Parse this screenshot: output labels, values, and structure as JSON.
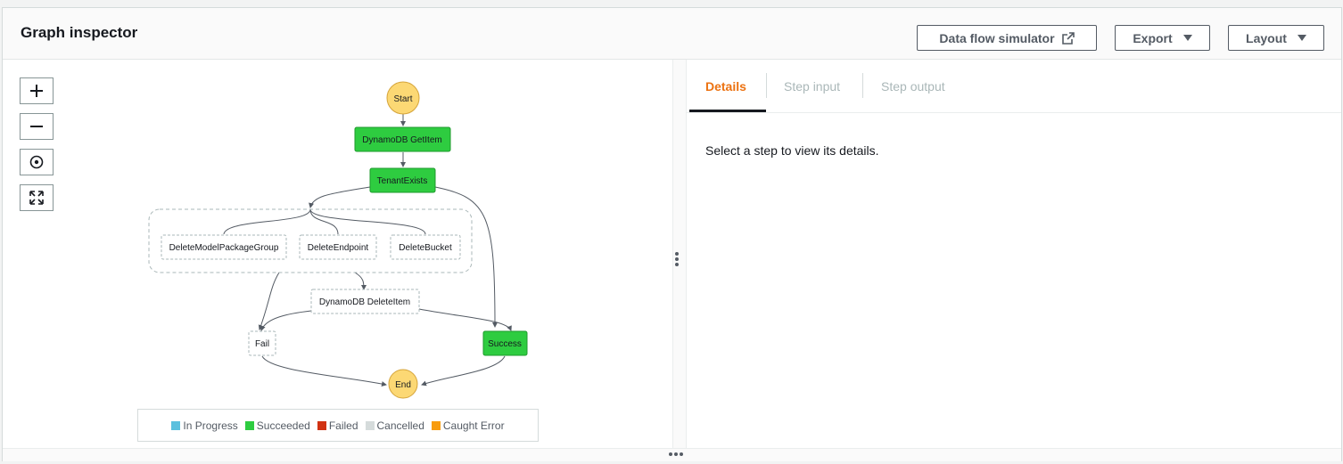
{
  "header": {
    "title": "Graph inspector",
    "buttons": {
      "simulator": "Data flow simulator",
      "export": "Export",
      "layout": "Layout"
    }
  },
  "zoom_controls": [
    "zoom-in",
    "zoom-out",
    "center",
    "fit-to-screen"
  ],
  "graph": {
    "start": "Start",
    "end": "End",
    "getitem": "DynamoDB GetItem",
    "tenantexists": "TenantExists",
    "parallel_branches": [
      "DeleteModelPackageGroup",
      "DeleteEndpoint",
      "DeleteBucket"
    ],
    "deleteitem": "DynamoDB DeleteItem",
    "fail": "Fail",
    "success": "Success"
  },
  "legend": [
    {
      "label": "In Progress",
      "color": "#5bc0de"
    },
    {
      "label": "Succeeded",
      "color": "#2ecc40"
    },
    {
      "label": "Failed",
      "color": "#d13212"
    },
    {
      "label": "Cancelled",
      "color": "#d5dbdb"
    },
    {
      "label": "Caught Error",
      "color": "#f89c0e"
    }
  ],
  "tabs": [
    "Details",
    "Step input",
    "Step output"
  ],
  "details_message": "Select a step to view its details.",
  "colors": {
    "succeeded": "#2ecc40",
    "terminal": "#fcd874",
    "active_tab": "#ec7211"
  }
}
